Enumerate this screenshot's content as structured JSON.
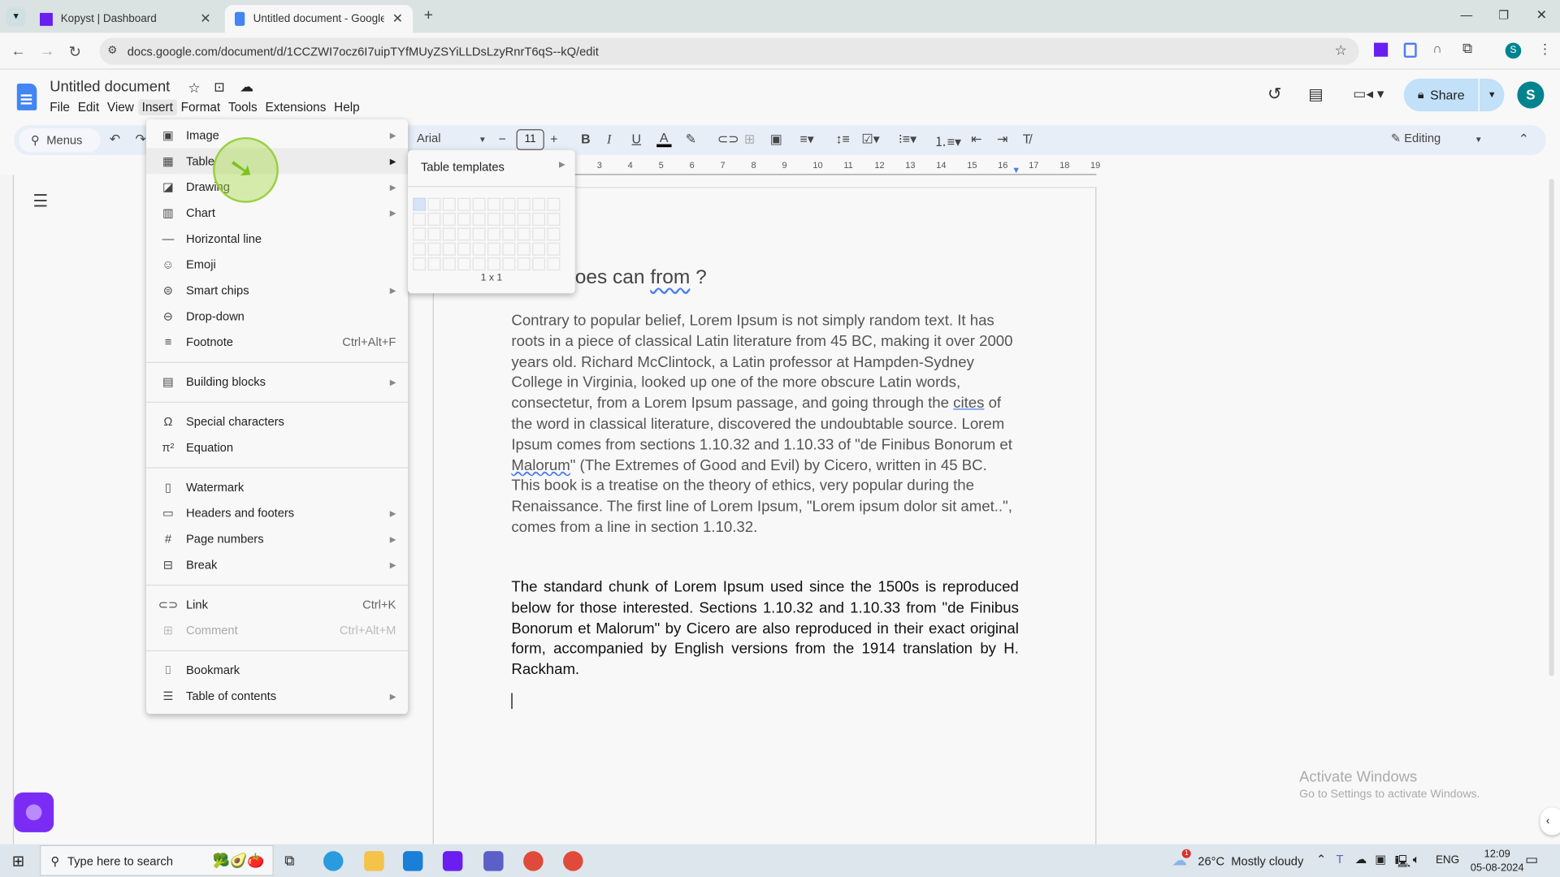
{
  "browser": {
    "tabs": [
      {
        "title": "Kopyst | Dashboard",
        "active": false
      },
      {
        "title": "Untitled document - Google Do",
        "active": true
      }
    ],
    "url": "docs.google.com/document/d/1CCZWI7ocz6I7uipTYfMUyZSYiLLDsLzyRnrT6qS--kQ/edit",
    "profile_initial": "S"
  },
  "docs": {
    "title": "Untitled document",
    "menus": [
      "File",
      "Edit",
      "View",
      "Insert",
      "Format",
      "Tools",
      "Extensions",
      "Help"
    ],
    "active_menu": "Insert",
    "share_label": "Share",
    "avatar_initial": "S",
    "toolbar": {
      "search_label": "Menus",
      "font": "Arial",
      "font_size": "11",
      "mode": "Editing"
    },
    "ruler_ticks": [
      "3",
      "4",
      "5",
      "6",
      "7",
      "8",
      "9",
      "10",
      "11",
      "12",
      "13",
      "14",
      "15",
      "16",
      "17",
      "18",
      "19"
    ]
  },
  "insert_menu": {
    "items": [
      {
        "label": "Image",
        "icon": "image-icon",
        "glyph": "▣",
        "submenu": true
      },
      {
        "label": "Table",
        "icon": "table-icon",
        "glyph": "▦",
        "submenu": true,
        "hover": true
      },
      {
        "label": "Drawing",
        "icon": "drawing-icon",
        "glyph": "◪",
        "submenu": true
      },
      {
        "label": "Chart",
        "icon": "chart-icon",
        "glyph": "▥",
        "submenu": true
      },
      {
        "label": "Horizontal line",
        "icon": "horizontal-line-icon",
        "glyph": "—"
      },
      {
        "label": "Emoji",
        "icon": "emoji-icon",
        "glyph": "☺"
      },
      {
        "label": "Smart chips",
        "icon": "smart-chips-icon",
        "glyph": "⊜",
        "submenu": true
      },
      {
        "label": "Drop-down",
        "icon": "dropdown-icon",
        "glyph": "⊖"
      },
      {
        "label": "Footnote",
        "icon": "footnote-icon",
        "glyph": "≡",
        "shortcut": "Ctrl+Alt+F"
      },
      {
        "sep": true
      },
      {
        "label": "Building blocks",
        "icon": "building-blocks-icon",
        "glyph": "▤",
        "submenu": true
      },
      {
        "sep": true
      },
      {
        "label": "Special characters",
        "icon": "omega-icon",
        "glyph": "Ω"
      },
      {
        "label": "Equation",
        "icon": "pi-icon",
        "glyph": "π²"
      },
      {
        "sep": true
      },
      {
        "label": "Watermark",
        "icon": "watermark-icon",
        "glyph": "▯"
      },
      {
        "label": "Headers and footers",
        "icon": "headers-footers-icon",
        "glyph": "▭",
        "submenu": true
      },
      {
        "label": "Page numbers",
        "icon": "hash-icon",
        "glyph": "#",
        "submenu": true
      },
      {
        "label": "Break",
        "icon": "break-icon",
        "glyph": "⊟",
        "submenu": true
      },
      {
        "sep": true
      },
      {
        "label": "Link",
        "icon": "link-icon",
        "glyph": "⊂⊃",
        "shortcut": "Ctrl+K"
      },
      {
        "label": "Comment",
        "icon": "comment-icon",
        "glyph": "⊞",
        "shortcut": "Ctrl+Alt+M",
        "disabled": true
      },
      {
        "sep": true
      },
      {
        "label": "Bookmark",
        "icon": "bookmark-icon",
        "glyph": "⌷"
      },
      {
        "label": "Table of contents",
        "icon": "toc-icon",
        "glyph": "☰",
        "submenu": true
      }
    ]
  },
  "table_submenu": {
    "templates_label": "Table templates",
    "size_label": "1 x 1"
  },
  "document": {
    "heading": "oes can from ?",
    "heading_underlined": "from",
    "para1": " Contrary to popular belief, Lorem Ipsum is not simply random text. It has roots in a piece of classical Latin literature from 45 BC, making it over 2000 years old. Richard McClintock, a Latin professor at Hampden-Sydney College in Virginia, looked up one of the more obscure Latin words, consectetur, from a Lorem Ipsum passage, and going through the cites of the word in classical literature, discovered the undoubtable source. Lorem Ipsum comes from sections 1.10.32 and 1.10.33 of \"de Finibus Bonorum et Malorum\" (The Extremes of Good and Evil) by Cicero, written in 45 BC. This book is a treatise on the theory of ethics, very popular during the Renaissance. The first line of Lorem Ipsum, \"Lorem ipsum dolor sit amet..\", comes from a line in section 1.10.32.",
    "para2": "The standard chunk of Lorem Ipsum used since the 1500s is reproduced below for those interested. Sections 1.10.32 and 1.10.33 from \"de Finibus Bonorum et Malorum\" by Cicero are also reproduced in their exact original form, accompanied by English versions from the 1914 translation by H. Rackham."
  },
  "activate_windows": {
    "title": "Activate Windows",
    "subtitle": "Go to Settings to activate Windows."
  },
  "taskbar": {
    "search_placeholder": "Type here to search",
    "weather": "26°C  Mostly cloudy",
    "weather_badge": "1",
    "lang": "ENG",
    "time": "12:09",
    "date": "05-08-2024"
  },
  "colors": {
    "accent": "#1a73e8",
    "share_bg": "#c2e0f8",
    "avatar": "#00838f",
    "cursor_highlight": "#a6d84f"
  }
}
